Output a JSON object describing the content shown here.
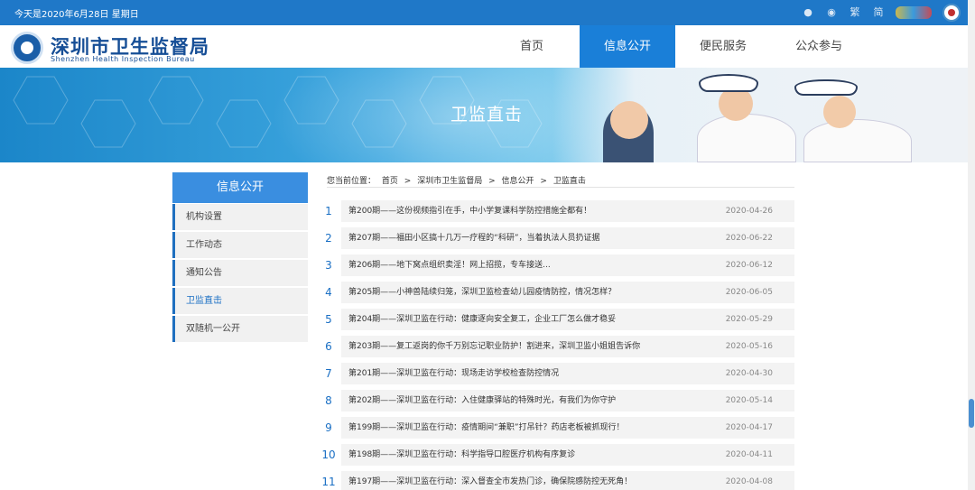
{
  "topbar": {
    "date_text": "今天是2020年6月28日 星期日",
    "icons": [
      "wechat-icon",
      "weibo-icon",
      "traditional-chinese-link",
      "simplified-chinese-link",
      "partner-logo",
      "emblem-seal"
    ],
    "trad_label": "繁",
    "simp_label": "简"
  },
  "header": {
    "logo_cn": "深圳市卫生监督局",
    "logo_en": "Shenzhen Health Inspection Bureau",
    "nav": [
      {
        "label": "首页",
        "active": false
      },
      {
        "label": "信息公开",
        "active": true
      },
      {
        "label": "便民服务",
        "active": false
      },
      {
        "label": "公众参与",
        "active": false
      }
    ]
  },
  "banner": {
    "title": "卫监直击"
  },
  "sidebar": {
    "heading": "信息公开",
    "items": [
      {
        "label": "机构设置",
        "active": false
      },
      {
        "label": "工作动态",
        "active": false
      },
      {
        "label": "通知公告",
        "active": false
      },
      {
        "label": "卫监直击",
        "active": true
      },
      {
        "label": "双随机一公开",
        "active": false
      }
    ]
  },
  "breadcrumb": {
    "prefix": "您当前位置：",
    "items": [
      "首页",
      "深圳市卫生监督局",
      "信息公开",
      "卫监直击"
    ],
    "separator": ">"
  },
  "articles": [
    {
      "num": "1",
      "title": "第200期——这份视频指引在手，中小学复课科学防控措施全都有！",
      "date": "2020-04-26"
    },
    {
      "num": "2",
      "title": "第207期——福田小区搞十几万一疗程的“科研”，当着执法人员扔证据",
      "date": "2020-06-22"
    },
    {
      "num": "3",
      "title": "第206期——地下窝点组织卖淫！网上招揽，专车接送...",
      "date": "2020-06-12"
    },
    {
      "num": "4",
      "title": "第205期——小神兽陆续归笼，深圳卫监检查幼儿园疫情防控，情况怎样？",
      "date": "2020-06-05"
    },
    {
      "num": "5",
      "title": "第204期——深圳卫监在行动：健康逐向安全复工，企业工厂怎么做才稳妥",
      "date": "2020-05-29"
    },
    {
      "num": "6",
      "title": "第203期——复工返岗的你千万别忘记职业防护！割进来，深圳卫监小姐姐告诉你",
      "date": "2020-05-16"
    },
    {
      "num": "7",
      "title": "第201期——深圳卫监在行动：现场走访学校检查防控情况",
      "date": "2020-04-30"
    },
    {
      "num": "8",
      "title": "第202期——深圳卫监在行动：入住健康驿站的特殊时光，有我们为你守护",
      "date": "2020-05-14"
    },
    {
      "num": "9",
      "title": "第199期——深圳卫监在行动：疫情期间“兼职”打吊针？药店老板被抓现行！",
      "date": "2020-04-17"
    },
    {
      "num": "10",
      "title": "第198期——深圳卫监在行动：科学指导口腔医疗机构有序复诊",
      "date": "2020-04-11"
    },
    {
      "num": "11",
      "title": "第197期——深圳卫监在行动：深入督查全市发热门诊，确保院感防控无死角！",
      "date": "2020-04-08"
    }
  ],
  "colors": {
    "brand_blue": "#1f78c8",
    "nav_active": "#1a7fd8",
    "logo_text": "#164e96",
    "link_blue": "#1a6fc4"
  }
}
